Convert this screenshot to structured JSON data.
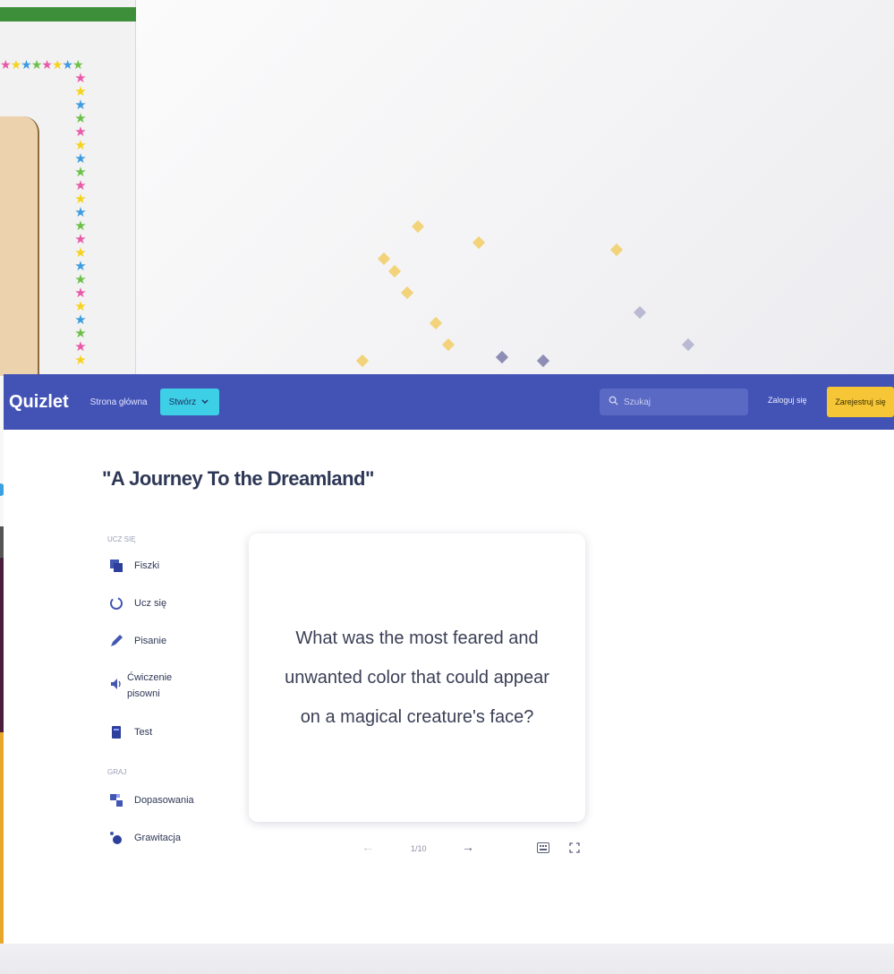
{
  "background": {
    "colors": {
      "green_bar": "#3d8f3a",
      "parchment": "#ecd3ad",
      "dark_strip": "#4a1d3c",
      "orange_block": "#e8a72a"
    },
    "star_glyph": "★"
  },
  "app": {
    "colors": {
      "topbar": "#4353b5",
      "create_button": "#3ccfe6",
      "signup_button": "#f6c636"
    },
    "header": {
      "logo": "Quizlet",
      "home_link": "Strona główna",
      "create_button": "Stwórz",
      "create_icon": "chevron-down-icon",
      "search_placeholder": "Szukaj",
      "search_icon": "search-icon",
      "login": "Zaloguj się",
      "signup": "Zarejestruj się"
    },
    "set_title": "\"A Journey To the Dreamland\"",
    "study_modes": {
      "learn_heading": "UCZ SIĘ",
      "learn_items": [
        {
          "label": "Fiszki",
          "icon": "flashcards-icon"
        },
        {
          "label": "Ucz się",
          "icon": "learn-icon"
        },
        {
          "label": "Pisanie",
          "icon": "write-icon"
        },
        {
          "label": "Ćwiczenie pisowni",
          "icon": "spell-icon"
        },
        {
          "label": "Test",
          "icon": "test-icon"
        }
      ],
      "games_heading": "GRAJ",
      "game_items": [
        {
          "label": "Dopasowania",
          "icon": "match-icon"
        },
        {
          "label": "Grawitacja",
          "icon": "gravity-icon"
        }
      ]
    },
    "flashcard": {
      "text": "What was the most feared and unwanted color that could appear on a magical creature's face?"
    },
    "controls": {
      "prev": "←",
      "counter": "1/10",
      "next": "→",
      "settings_icon": "keyboard-icon",
      "fullscreen_icon": "fullscreen-icon"
    }
  }
}
